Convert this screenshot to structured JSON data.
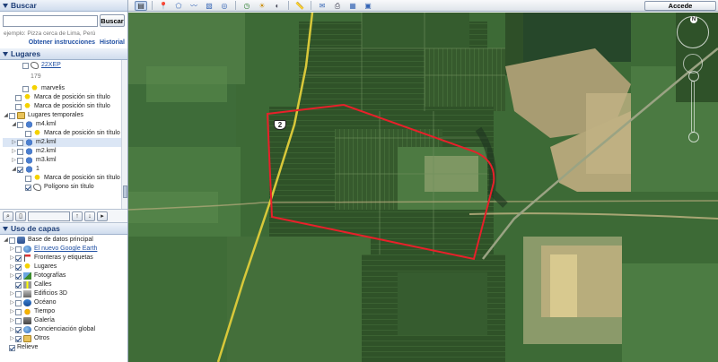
{
  "search": {
    "header": "Buscar",
    "input_value": "",
    "button": "Buscar",
    "example": "ejemplo: Pizza cerca de Lima, Perú",
    "link_directions": "Obtener instrucciones",
    "link_history": "Historial"
  },
  "places": {
    "header": "Lugares",
    "rows": [
      {
        "label": "22XEP",
        "type": "link"
      },
      {
        "label": "179",
        "type": "dim"
      },
      {
        "label": "marvelis"
      },
      {
        "label": "Marca de posición sin título"
      },
      {
        "label": "Marca de posición sin título"
      },
      {
        "label": "Lugares temporales"
      },
      {
        "label": "m4.kml"
      },
      {
        "label": "Marca de posición sin título"
      },
      {
        "label": "m2.kml"
      },
      {
        "label": "m2.kml"
      },
      {
        "label": "m3.kml"
      },
      {
        "label": "1"
      },
      {
        "label": "Marca de posición sin título"
      },
      {
        "label": "Polígono sin título"
      }
    ]
  },
  "layers": {
    "header": "Uso de capas",
    "items": [
      "Base de datos principal",
      "El nuevo Google Earth",
      "Fronteras y etiquetas",
      "Lugares",
      "Fotografías",
      "Calles",
      "Edificios 3D",
      "Océano",
      "Tiempo",
      "Galería",
      "Conciencia­ción global",
      "Otros",
      "Relieve"
    ]
  },
  "toolbar": {
    "signin": "Accede"
  },
  "map": {
    "road_shield": "2",
    "compass_north": "N",
    "polygon_color": "#e8202a"
  }
}
